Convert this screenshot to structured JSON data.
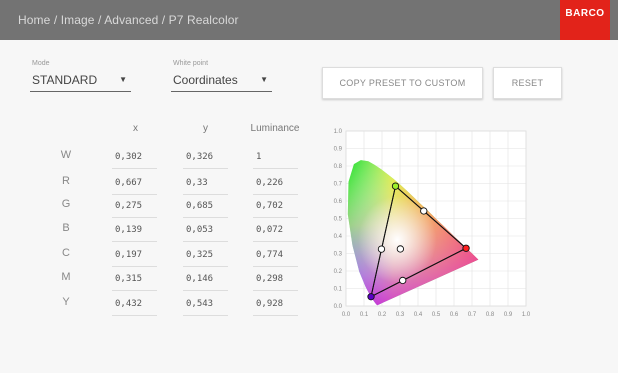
{
  "header": {
    "breadcrumb": "Home / Image / Advanced / P7 Realcolor",
    "logo_text": "BARCO",
    "logo_color": "#e2231a"
  },
  "mode": {
    "label": "Mode",
    "value": "STANDARD"
  },
  "white_point": {
    "label": "White point",
    "value": "Coordinates"
  },
  "buttons": {
    "copy_preset": "COPY PRESET TO CUSTOM",
    "reset": "RESET"
  },
  "table": {
    "columns": [
      "x",
      "y",
      "Luminance"
    ],
    "rows": [
      {
        "label": "W",
        "x": "0,302",
        "y": "0,326",
        "lum": "1"
      },
      {
        "label": "R",
        "x": "0,667",
        "y": "0,33",
        "lum": "0,226"
      },
      {
        "label": "G",
        "x": "0,275",
        "y": "0,685",
        "lum": "0,702"
      },
      {
        "label": "B",
        "x": "0,139",
        "y": "0,053",
        "lum": "0,072"
      },
      {
        "label": "C",
        "x": "0,197",
        "y": "0,325",
        "lum": "0,774"
      },
      {
        "label": "M",
        "x": "0,315",
        "y": "0,146",
        "lum": "0,298"
      },
      {
        "label": "Y",
        "x": "0,432",
        "y": "0,543",
        "lum": "0,928"
      }
    ]
  },
  "chart_data": {
    "type": "scatter",
    "x_ticks": [
      "0.0",
      "0.1",
      "0.2",
      "0.3",
      "0.4",
      "0.5",
      "0.6",
      "0.7",
      "0.8",
      "0.9",
      "1.0"
    ],
    "y_ticks": [
      "0.0",
      "0.1",
      "0.2",
      "0.3",
      "0.4",
      "0.5",
      "0.6",
      "0.7",
      "0.8",
      "0.9",
      "1.0"
    ],
    "xlim": [
      0,
      1
    ],
    "ylim": [
      0,
      1
    ],
    "grid": true,
    "points": [
      {
        "id": "W",
        "x": 0.302,
        "y": 0.326
      },
      {
        "id": "R",
        "x": 0.667,
        "y": 0.33
      },
      {
        "id": "G",
        "x": 0.275,
        "y": 0.685
      },
      {
        "id": "B",
        "x": 0.139,
        "y": 0.053
      },
      {
        "id": "C",
        "x": 0.197,
        "y": 0.325
      },
      {
        "id": "M",
        "x": 0.315,
        "y": 0.146
      },
      {
        "id": "Y",
        "x": 0.432,
        "y": 0.543
      }
    ]
  }
}
